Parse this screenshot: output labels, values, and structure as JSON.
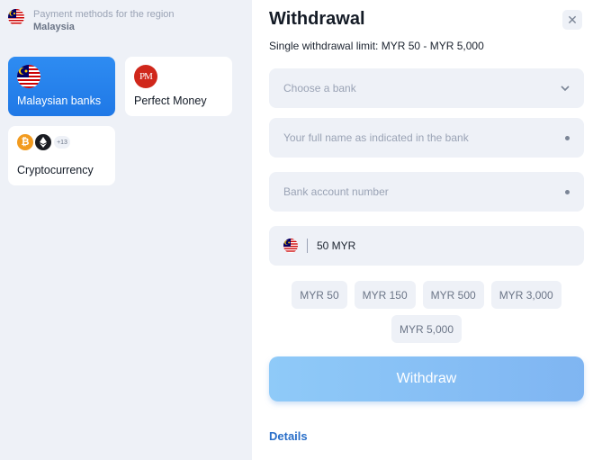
{
  "region": {
    "label": "Payment methods for the region",
    "country": "Malaysia"
  },
  "methods": [
    {
      "label": "Malaysian banks",
      "icon": "malaysia-flag-icon",
      "active": true
    },
    {
      "label": "Perfect Money",
      "icon": "perfect-money-icon",
      "badge": "PM"
    },
    {
      "label": "Cryptocurrency",
      "icons": [
        "bitcoin-icon",
        "ethereum-icon"
      ],
      "more": "+13"
    }
  ],
  "withdrawal": {
    "title": "Withdrawal",
    "limit": "Single withdrawal limit: MYR 50 - MYR 5,000",
    "bank_select": {
      "placeholder": "Choose a bank"
    },
    "full_name": {
      "placeholder": "Your full name as indicated in the bank"
    },
    "account_number": {
      "placeholder": "Bank account number"
    },
    "amount": {
      "value": "50 MYR"
    },
    "quick_amounts": [
      "MYR 50",
      "MYR 150",
      "MYR 500",
      "MYR 3,000",
      "MYR 5,000"
    ],
    "submit_label": "Withdraw",
    "details_link": "Details"
  },
  "colors": {
    "accent": "#1f78e6",
    "button": "#8fcaf8",
    "link": "#2a6fc9",
    "field_bg": "#eef1f7"
  }
}
